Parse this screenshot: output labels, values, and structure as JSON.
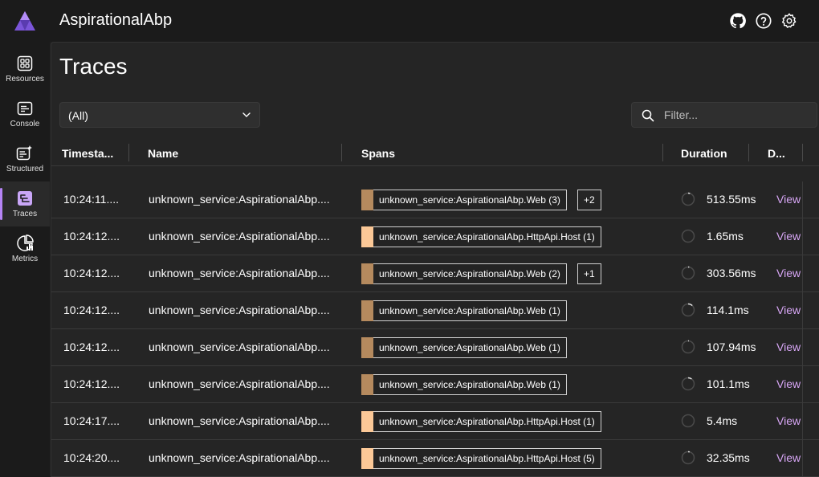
{
  "app": {
    "title": "AspirationalAbp"
  },
  "header": {
    "icons": [
      "github-icon",
      "help-icon",
      "settings-icon"
    ]
  },
  "sidebar": {
    "items": [
      {
        "label": "Resources",
        "icon": "resources-icon",
        "active": false
      },
      {
        "label": "Console",
        "icon": "console-icon",
        "active": false
      },
      {
        "label": "Structured",
        "icon": "structured-icon",
        "active": false
      },
      {
        "label": "Traces",
        "icon": "traces-icon",
        "active": true
      },
      {
        "label": "Metrics",
        "icon": "metrics-icon",
        "active": false
      }
    ]
  },
  "page": {
    "title": "Traces"
  },
  "resource_select": {
    "value": "(All)"
  },
  "filter": {
    "placeholder": "Filter...",
    "value": ""
  },
  "table": {
    "columns": [
      "Timesta...",
      "Name",
      "Spans",
      "Duration",
      "D..."
    ],
    "rows": [
      {
        "timestamp": "10:24:11....",
        "name": "unknown_service:AspirationalAbp....",
        "span": "unknown_service:AspirationalAbp.Web (3)",
        "span_color": "#b58a5e",
        "extra": "+2",
        "duration": "513.55ms",
        "duration_fill": 0.05,
        "action": "View"
      },
      {
        "timestamp": "10:24:12....",
        "name": "unknown_service:AspirationalAbp....",
        "span": "unknown_service:AspirationalAbp.HttpApi.Host (1)",
        "span_color": "#fbc897",
        "extra": "",
        "duration": "1.65ms",
        "duration_fill": 0.0,
        "action": "View"
      },
      {
        "timestamp": "10:24:12....",
        "name": "unknown_service:AspirationalAbp....",
        "span": "unknown_service:AspirationalAbp.Web (2)",
        "span_color": "#b58a5e",
        "extra": "+1",
        "duration": "303.56ms",
        "duration_fill": 0.03,
        "action": "View"
      },
      {
        "timestamp": "10:24:12....",
        "name": "unknown_service:AspirationalAbp....",
        "span": "unknown_service:AspirationalAbp.Web (1)",
        "span_color": "#b58a5e",
        "extra": "",
        "duration": "114.1ms",
        "duration_fill": 0.12,
        "action": "View"
      },
      {
        "timestamp": "10:24:12....",
        "name": "unknown_service:AspirationalAbp....",
        "span": "unknown_service:AspirationalAbp.Web (1)",
        "span_color": "#b58a5e",
        "extra": "",
        "duration": "107.94ms",
        "duration_fill": 0.02,
        "action": "View"
      },
      {
        "timestamp": "10:24:12....",
        "name": "unknown_service:AspirationalAbp....",
        "span": "unknown_service:AspirationalAbp.Web (1)",
        "span_color": "#b58a5e",
        "extra": "",
        "duration": "101.1ms",
        "duration_fill": 0.1,
        "action": "View"
      },
      {
        "timestamp": "10:24:17....",
        "name": "unknown_service:AspirationalAbp....",
        "span": "unknown_service:AspirationalAbp.HttpApi.Host (1)",
        "span_color": "#fbc897",
        "extra": "",
        "duration": "5.4ms",
        "duration_fill": 0.0,
        "action": "View"
      },
      {
        "timestamp": "10:24:20....",
        "name": "unknown_service:AspirationalAbp....",
        "span": "unknown_service:AspirationalAbp.HttpApi.Host (5)",
        "span_color": "#fbc897",
        "extra": "",
        "duration": "32.35ms",
        "duration_fill": 0.04,
        "action": "View"
      }
    ]
  },
  "colors": {
    "accent": "#b584f5",
    "link": "#d7a6f5",
    "web_span": "#b58a5e",
    "api_span": "#fbc897"
  }
}
